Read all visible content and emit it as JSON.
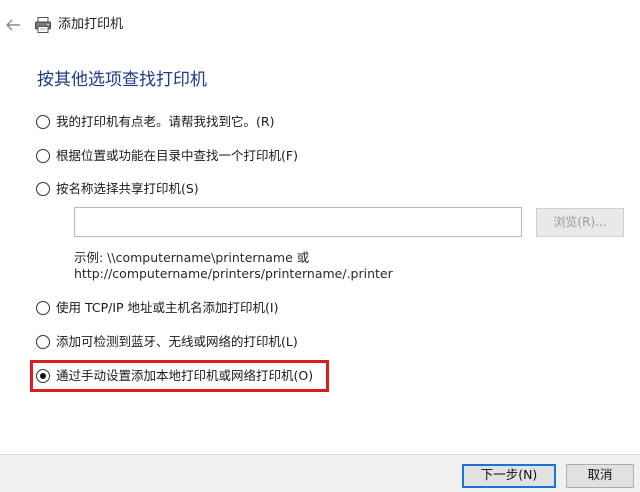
{
  "window": {
    "title": "添加打印机"
  },
  "icons": {
    "back": "back-arrow-icon",
    "printer": "printer-icon"
  },
  "colors": {
    "heading": "#1e3a8a",
    "highlight_border": "#d81e1e",
    "primary_button_border": "#1e73d6"
  },
  "main": {
    "heading": "按其他选项查找打印机",
    "options": [
      {
        "label": "我的打印机有点老。请帮我找到它。(R)",
        "checked": false
      },
      {
        "label": "根据位置或功能在目录中查找一个打印机(F)",
        "checked": false
      },
      {
        "label": "按名称选择共享打印机(S)",
        "checked": false
      },
      {
        "label": "使用 TCP/IP 地址或主机名添加打印机(I)",
        "checked": false
      },
      {
        "label": "添加可检测到蓝牙、无线或网络的打印机(L)",
        "checked": false
      },
      {
        "label": "通过手动设置添加本地打印机或网络打印机(O)",
        "checked": true
      }
    ],
    "share_name_input": {
      "value": "",
      "placeholder": ""
    },
    "browse_label": "浏览(R)...",
    "example_line1": "示例: \\\\computername\\printername 或",
    "example_line2": "http://computername/printers/printername/.printer"
  },
  "footer": {
    "next_label": "下一步(N)",
    "cancel_label": "取消"
  }
}
